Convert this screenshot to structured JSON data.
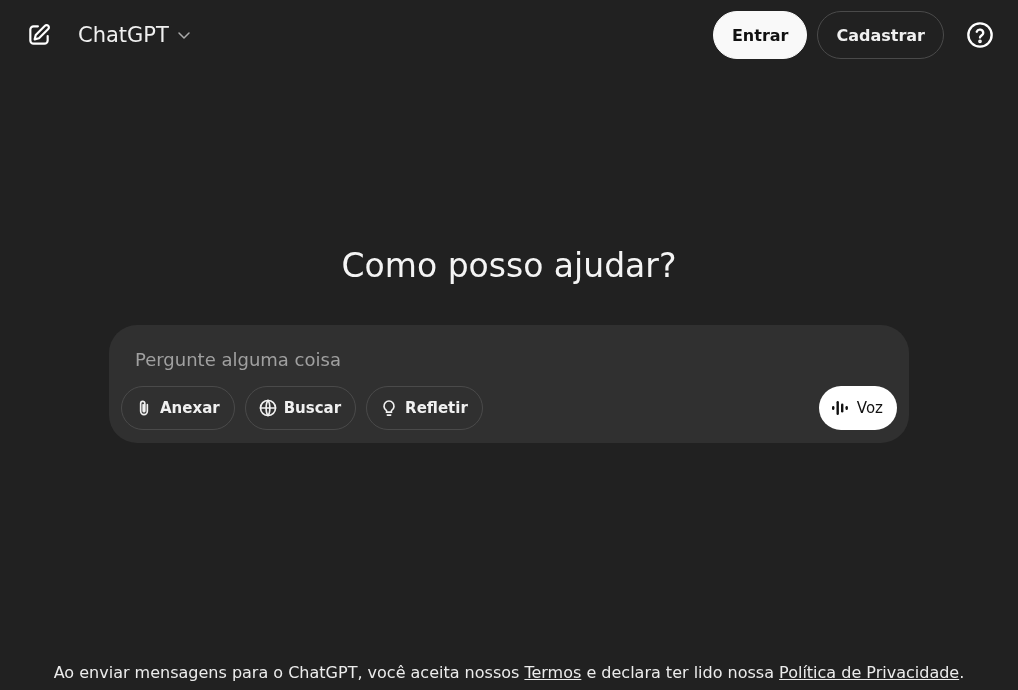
{
  "header": {
    "app_name": "ChatGPT",
    "buttons": [
      {
        "label": "Entrar",
        "kind": "primary"
      },
      {
        "label": "Cadastrar",
        "kind": "outline"
      }
    ]
  },
  "heading": "Como posso ajudar?",
  "composer": {
    "placeholder": "Pergunte alguma coisa",
    "tools": [
      {
        "label": "Anexar",
        "kind": "attach"
      },
      {
        "label": "Buscar",
        "kind": "globe"
      },
      {
        "label": "Refletir",
        "kind": "bulb"
      }
    ],
    "voice_button": "Voz"
  },
  "footer": [
    {
      "kind": "text",
      "text": "Ao enviar mensagens para o ChatGPT, você aceita nossos "
    },
    {
      "kind": "link",
      "text": "Termos"
    },
    {
      "kind": "text",
      "text": " e declara ter lido nossa "
    },
    {
      "kind": "link",
      "text": "Política de Privacidade"
    },
    {
      "kind": "text",
      "text": "."
    }
  ]
}
